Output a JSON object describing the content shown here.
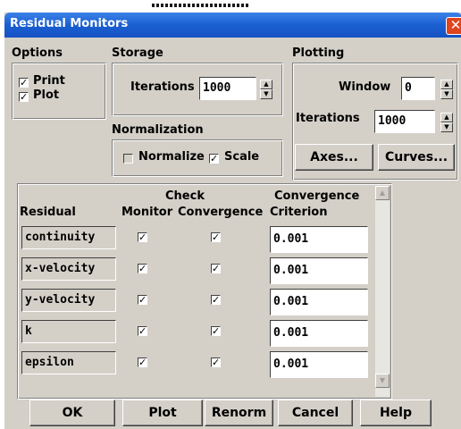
{
  "window": {
    "title": "Residual Monitors",
    "close_glyph": "✕"
  },
  "options": {
    "title": "Options",
    "print_label": "Print",
    "print_checked": true,
    "plot_label": "Plot",
    "plot_checked": true
  },
  "storage": {
    "title": "Storage",
    "iterations_label": "Iterations",
    "iterations_value": "1000"
  },
  "plotting": {
    "title": "Plotting",
    "window_label": "Window",
    "window_value": "0",
    "iterations_label": "Iterations",
    "iterations_value": "1000",
    "axes_button": "Axes...",
    "curves_button": "Curves..."
  },
  "normalization": {
    "title": "Normalization",
    "normalize_label": "Normalize",
    "normalize_checked": false,
    "scale_label": "Scale",
    "scale_checked": true
  },
  "table": {
    "headers": {
      "residual": "Residual",
      "monitor": "Monitor",
      "check_line1": "Check",
      "check_line2": "Convergence",
      "criterion_line1": "Convergence",
      "criterion_line2": "Criterion"
    },
    "rows": [
      {
        "name": "continuity",
        "monitor": true,
        "check": true,
        "criterion": "0.001"
      },
      {
        "name": "x-velocity",
        "monitor": true,
        "check": true,
        "criterion": "0.001"
      },
      {
        "name": "y-velocity",
        "monitor": true,
        "check": true,
        "criterion": "0.001"
      },
      {
        "name": "k",
        "monitor": true,
        "check": true,
        "criterion": "0.001"
      },
      {
        "name": "epsilon",
        "monitor": true,
        "check": true,
        "criterion": "0.001"
      }
    ]
  },
  "buttons": {
    "ok": "OK",
    "plot": "Plot",
    "renorm": "Renorm",
    "cancel": "Cancel",
    "help": "Help"
  },
  "glyphs": {
    "check": "✓",
    "up": "▲",
    "down": "▼"
  }
}
